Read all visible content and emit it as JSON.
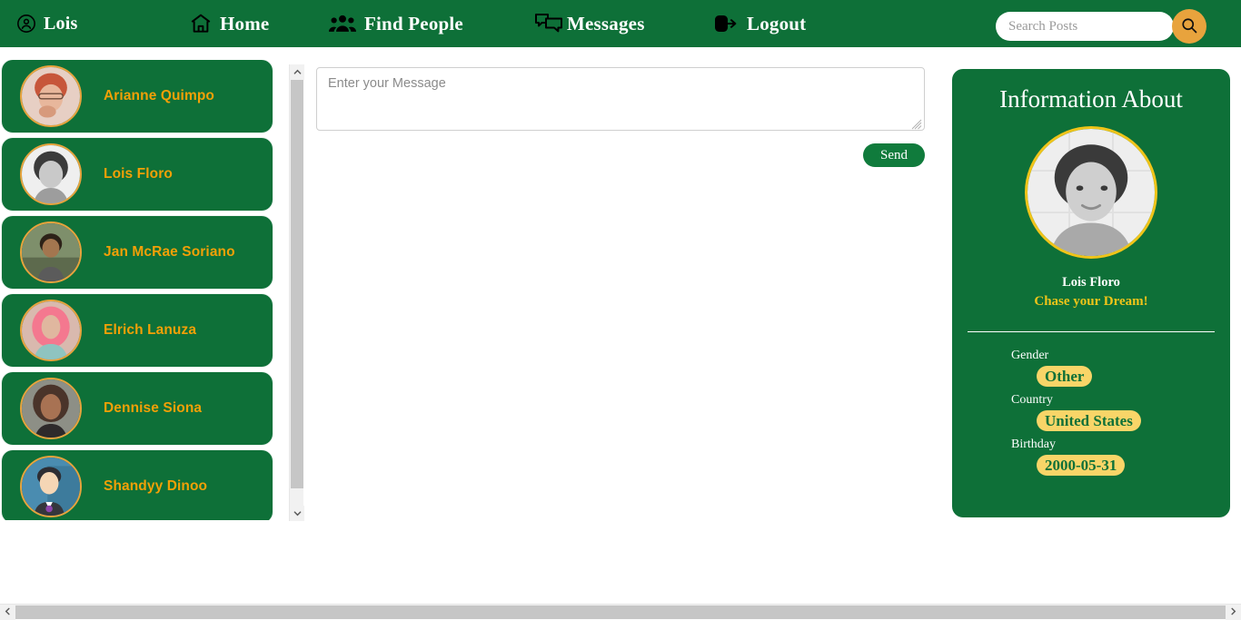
{
  "navbar": {
    "brand": {
      "label": "Lois",
      "icon": "user-circle-icon"
    },
    "items": [
      {
        "label": "Home",
        "icon": "home-icon"
      },
      {
        "label": "Find People",
        "icon": "users-group-icon"
      },
      {
        "label": "Messages",
        "icon": "chat-bubbles-icon"
      },
      {
        "label": "Logout",
        "icon": "logout-icon"
      }
    ],
    "search": {
      "placeholder": "Search Posts",
      "value": "",
      "button_icon": "search-icon",
      "button_color": "#e8a33d"
    },
    "background_color": "#0e7038"
  },
  "friends": {
    "items": [
      {
        "name": "Arianne Quimpo"
      },
      {
        "name": "Lois Floro"
      },
      {
        "name": "Jan McRae Soriano"
      },
      {
        "name": "Elrich Lanuza"
      },
      {
        "name": "Dennise Siona"
      },
      {
        "name": "Shandyy Dinoo"
      }
    ],
    "card_color": "#0e7038",
    "name_color": "#f2a007",
    "avatar_ring_color": "#e8a33d"
  },
  "compose": {
    "placeholder": "Enter your Message",
    "value": "",
    "send_label": "Send",
    "send_color": "#107b3c"
  },
  "info_panel": {
    "title": "Information About",
    "name": "Lois Floro",
    "tagline": "Chase your Dream!",
    "fields": [
      {
        "label": "Gender",
        "value": "Other"
      },
      {
        "label": "Country",
        "value": "United States"
      },
      {
        "label": "Birthday",
        "value": "2000-05-31"
      }
    ],
    "background_color": "#0e7038",
    "value_chip_color": "#f8d568",
    "accent_color": "#f0c419"
  },
  "scrollbars": {
    "vertical": {
      "up_icon": "chevron-up-icon",
      "down_icon": "chevron-down-icon"
    },
    "horizontal": {
      "left_icon": "chevron-left-icon",
      "right_icon": "chevron-right-icon"
    }
  }
}
